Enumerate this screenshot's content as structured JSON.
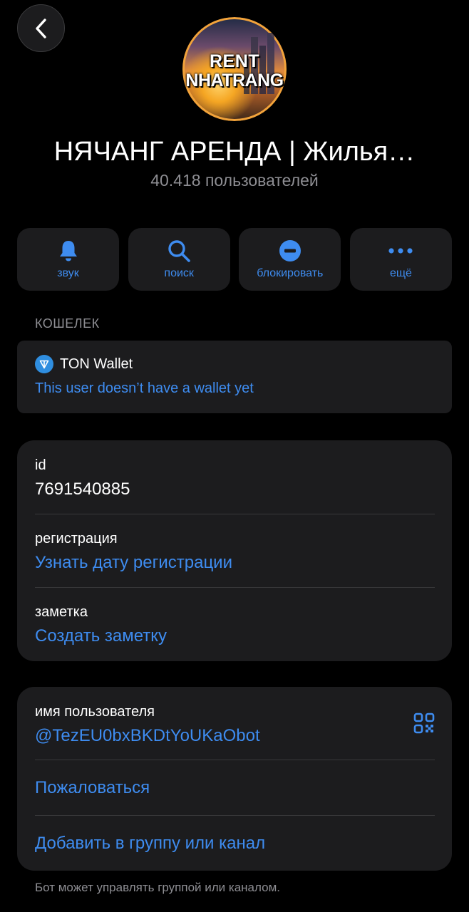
{
  "header": {
    "avatar_line1": "RENT",
    "avatar_line2": "NHATRANG",
    "title": "НЯЧАНГ АРЕНДА | Жилья…",
    "subtitle": "40.418 пользователей"
  },
  "actions": [
    {
      "label": "звук",
      "icon": "bell-icon"
    },
    {
      "label": "поиск",
      "icon": "search-icon"
    },
    {
      "label": "блокировать",
      "icon": "block-icon"
    },
    {
      "label": "ещё",
      "icon": "more-dots-icon"
    }
  ],
  "wallet": {
    "section_label": "КОШЕЛЕК",
    "name": "TON Wallet",
    "status": "This user doesn’t have a wallet yet"
  },
  "info": {
    "id_label": "id",
    "id_value": "7691540885",
    "reg_label": "регистрация",
    "reg_value": "Узнать дату регистрации",
    "note_label": "заметка",
    "note_value": "Создать заметку"
  },
  "user": {
    "username_label": "имя пользователя",
    "username_value": "@TezEU0bxBKDtYoUKaObot",
    "report": "Пожаловаться",
    "add_to_group": "Добавить в группу или канал"
  },
  "footer": {
    "note": "Бот может управлять группой или каналом."
  },
  "colors": {
    "accent": "#3e8cf0",
    "card": "#1c1c1e",
    "secondary_text": "#8e8e93"
  }
}
